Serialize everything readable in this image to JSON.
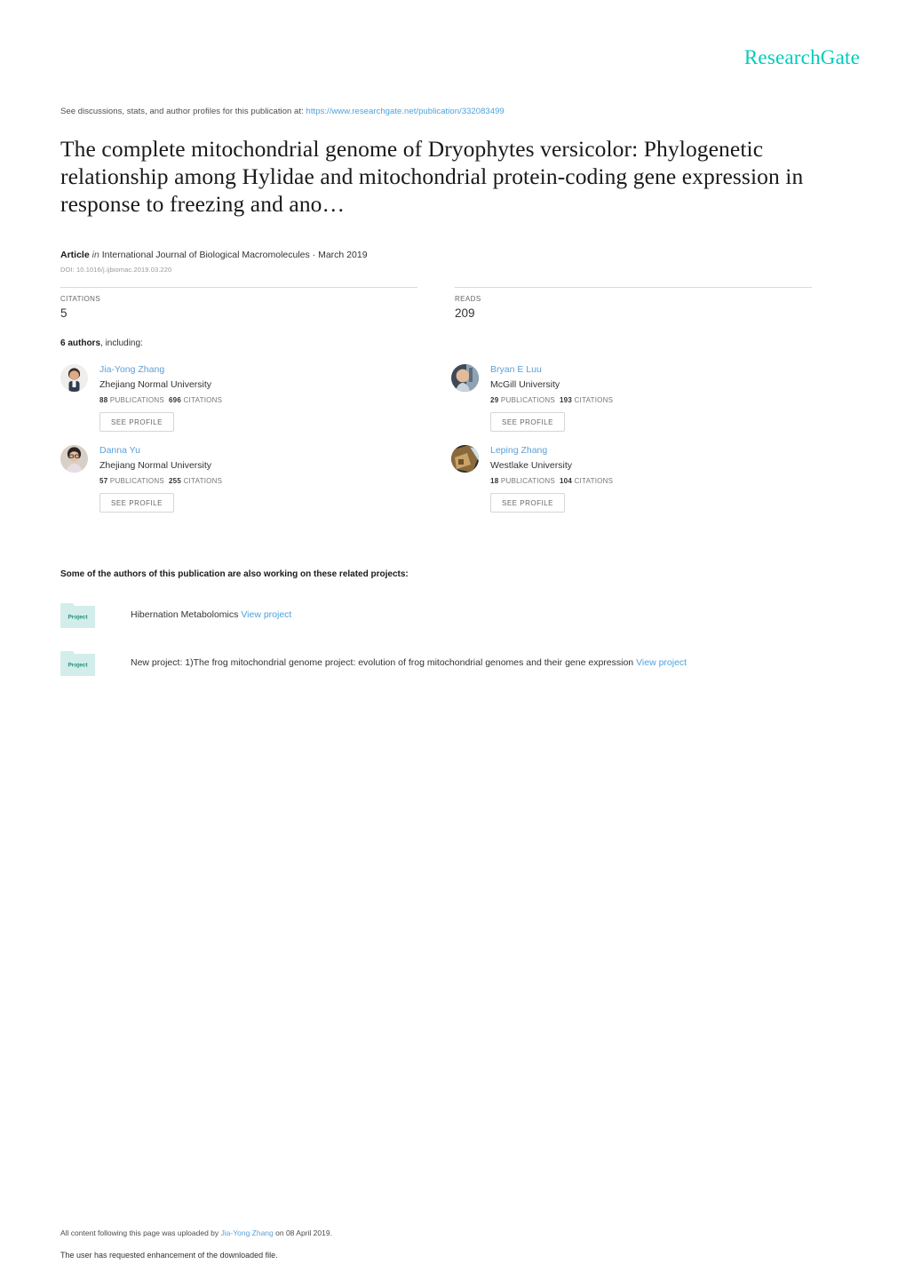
{
  "brand": {
    "logo_text": "ResearchGate",
    "logo_color": "#00ccbb"
  },
  "header": {
    "discussions_prefix": "See discussions, stats, and author profiles for this publication at:",
    "publication_url": "https://www.researchgate.net/publication/332083499"
  },
  "publication": {
    "title": "The complete mitochondrial genome of Dryophytes versicolor: Phylogenetic relationship among Hylidae and mitochondrial protein‐coding gene expression in response to freezing and ano…",
    "type_label": "Article",
    "in_label": "in",
    "journal_and_date": "International Journal of Biological Macromolecules · March 2019",
    "doi": "DOI: 10.1016/j.ijbiomac.2019.03.220"
  },
  "stats": [
    {
      "label": "CITATIONS",
      "value": "5"
    },
    {
      "label": "READS",
      "value": "209"
    }
  ],
  "authors_section": {
    "count_label": "6 authors",
    "count_suffix": ", including:",
    "see_profile_label": "SEE PROFILE",
    "publications_label": "PUBLICATIONS",
    "citations_label": "CITATIONS",
    "authors": [
      {
        "name": "Jia-Yong Zhang",
        "affiliation": "Zhejiang Normal University",
        "publications": "88",
        "citations": "696"
      },
      {
        "name": "Bryan E Luu",
        "affiliation": "McGill University",
        "publications": "29",
        "citations": "193"
      },
      {
        "name": "Danna Yu",
        "affiliation": "Zhejiang Normal University",
        "publications": "57",
        "citations": "255"
      },
      {
        "name": "Leping Zhang",
        "affiliation": "Westlake University",
        "publications": "18",
        "citations": "104"
      }
    ]
  },
  "projects_section": {
    "heading": "Some of the authors of this publication are also working on these related projects:",
    "icon_label": "Project",
    "view_link_label": "View project",
    "projects": [
      {
        "title": "Hibernation Metabolomics"
      },
      {
        "title": "New project: 1)The frog mitochondrial genome project: evolution of frog mitochondrial genomes and their gene expression"
      }
    ]
  },
  "footer": {
    "line1_prefix": "All content following this page was uploaded by",
    "uploader": "Jia-Yong Zhang",
    "line1_suffix": "on 08 April 2019.",
    "line2": "The user has requested enhancement of the downloaded file."
  }
}
